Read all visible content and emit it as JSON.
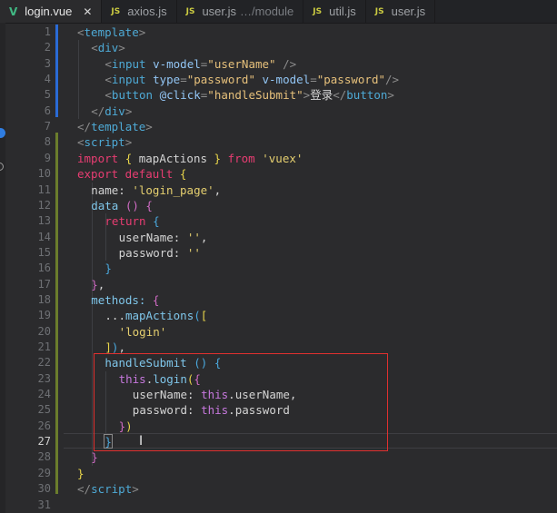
{
  "tabs": [
    {
      "icon": "V",
      "icon_type": "vue",
      "label": "login.vue",
      "suffix": "",
      "active": true,
      "close": "✕"
    },
    {
      "icon": "JS",
      "icon_type": "js",
      "label": "axios.js",
      "suffix": "",
      "active": false
    },
    {
      "icon": "JS",
      "icon_type": "js",
      "label": "user.js",
      "suffix": "…/module",
      "active": false
    },
    {
      "icon": "JS",
      "icon_type": "js",
      "label": "util.js",
      "suffix": "",
      "active": false
    },
    {
      "icon": "JS",
      "icon_type": "js",
      "label": "user.js",
      "suffix": "",
      "active": false
    }
  ],
  "editor": {
    "current_line": 27,
    "lines": [
      {
        "n": 1,
        "tokens": [
          [
            "t-punc",
            "<"
          ],
          [
            "t-tag",
            "template"
          ],
          [
            "t-punc",
            ">"
          ]
        ],
        "indent": 0
      },
      {
        "n": 2,
        "tokens": [
          [
            "t-punc",
            "<"
          ],
          [
            "t-tag",
            "div"
          ],
          [
            "t-punc",
            ">"
          ]
        ],
        "indent": 1
      },
      {
        "n": 3,
        "tokens": [
          [
            "t-punc",
            "<"
          ],
          [
            "t-tag",
            "input "
          ],
          [
            "t-attr",
            "v-model"
          ],
          [
            "t-punc",
            "="
          ],
          [
            "t-str",
            "\"userName\""
          ],
          [
            "t-punc",
            " />"
          ]
        ],
        "indent": 2
      },
      {
        "n": 4,
        "tokens": [
          [
            "t-punc",
            "<"
          ],
          [
            "t-tag",
            "input "
          ],
          [
            "t-attr",
            "type"
          ],
          [
            "t-punc",
            "="
          ],
          [
            "t-str",
            "\"password\""
          ],
          [
            "t-attr",
            " v-model"
          ],
          [
            "t-punc",
            "="
          ],
          [
            "t-str",
            "\"password\""
          ],
          [
            "t-punc",
            "/>"
          ]
        ],
        "indent": 2
      },
      {
        "n": 5,
        "tokens": [
          [
            "t-punc",
            "<"
          ],
          [
            "t-tag",
            "button "
          ],
          [
            "t-attr",
            "@click"
          ],
          [
            "t-punc",
            "="
          ],
          [
            "t-str",
            "\"handleSubmit\""
          ],
          [
            "t-punc",
            ">"
          ],
          [
            "t-prop",
            "登录"
          ],
          [
            "t-punc",
            "</"
          ],
          [
            "t-tag",
            "button"
          ],
          [
            "t-punc",
            ">"
          ]
        ],
        "indent": 2
      },
      {
        "n": 6,
        "tokens": [
          [
            "t-punc",
            "</"
          ],
          [
            "t-tag",
            "div"
          ],
          [
            "t-punc",
            ">"
          ]
        ],
        "indent": 1
      },
      {
        "n": 7,
        "tokens": [
          [
            "t-punc",
            "</"
          ],
          [
            "t-tag",
            "template"
          ],
          [
            "t-punc",
            ">"
          ]
        ],
        "indent": 0
      },
      {
        "n": 8,
        "tokens": [
          [
            "t-punc",
            "<"
          ],
          [
            "t-tag",
            "script"
          ],
          [
            "t-punc",
            ">"
          ]
        ],
        "indent": 0
      },
      {
        "n": 9,
        "tokens": [
          [
            "t-kw",
            "import "
          ],
          [
            "t-brace",
            "{ "
          ],
          [
            "t-prop",
            "mapActions "
          ],
          [
            "t-brace",
            "} "
          ],
          [
            "t-kw",
            "from "
          ],
          [
            "t-str2",
            "'vuex'"
          ]
        ],
        "indent": 0
      },
      {
        "n": 10,
        "tokens": [
          [
            "t-kw",
            "export default "
          ],
          [
            "t-brace",
            "{"
          ]
        ],
        "indent": 0
      },
      {
        "n": 11,
        "tokens": [
          [
            "t-prop",
            "name: "
          ],
          [
            "t-str2",
            "'login_page'"
          ],
          [
            "t-prop",
            ","
          ]
        ],
        "indent": 1
      },
      {
        "n": 12,
        "tokens": [
          [
            "t-fn",
            "data "
          ],
          [
            "t-brace2",
            "() "
          ],
          [
            "t-brace2",
            "{"
          ]
        ],
        "indent": 1
      },
      {
        "n": 13,
        "tokens": [
          [
            "t-kw",
            "return "
          ],
          [
            "t-brace3",
            "{"
          ]
        ],
        "indent": 2
      },
      {
        "n": 14,
        "tokens": [
          [
            "t-prop",
            "userName: "
          ],
          [
            "t-str2",
            "''"
          ],
          [
            "t-prop",
            ","
          ]
        ],
        "indent": 3
      },
      {
        "n": 15,
        "tokens": [
          [
            "t-prop",
            "password: "
          ],
          [
            "t-str2",
            "''"
          ]
        ],
        "indent": 3
      },
      {
        "n": 16,
        "tokens": [
          [
            "t-brace3",
            "}"
          ]
        ],
        "indent": 2
      },
      {
        "n": 17,
        "tokens": [
          [
            "t-brace2",
            "}"
          ],
          [
            "t-prop",
            ","
          ]
        ],
        "indent": 1
      },
      {
        "n": 18,
        "tokens": [
          [
            "t-fn",
            "methods: "
          ],
          [
            "t-brace2",
            "{"
          ]
        ],
        "indent": 1
      },
      {
        "n": 19,
        "tokens": [
          [
            "t-prop",
            "..."
          ],
          [
            "t-fn",
            "mapActions"
          ],
          [
            "t-brace3",
            "("
          ],
          [
            "t-brace",
            "["
          ]
        ],
        "indent": 2
      },
      {
        "n": 20,
        "tokens": [
          [
            "t-str2",
            "'login'"
          ]
        ],
        "indent": 3
      },
      {
        "n": 21,
        "tokens": [
          [
            "t-brace",
            "]"
          ],
          [
            "t-brace3",
            ")"
          ],
          [
            "t-prop",
            ","
          ]
        ],
        "indent": 2
      },
      {
        "n": 22,
        "tokens": [
          [
            "t-fn",
            "handleSubmit "
          ],
          [
            "t-brace3",
            "() "
          ],
          [
            "t-brace3",
            "{"
          ]
        ],
        "indent": 2
      },
      {
        "n": 23,
        "tokens": [
          [
            "t-this",
            "this"
          ],
          [
            "t-prop",
            "."
          ],
          [
            "t-fn",
            "login"
          ],
          [
            "t-brace",
            "("
          ],
          [
            "t-brace2",
            "{"
          ]
        ],
        "indent": 3
      },
      {
        "n": 24,
        "tokens": [
          [
            "t-prop",
            "userName: "
          ],
          [
            "t-this",
            "this"
          ],
          [
            "t-prop",
            ".userName,"
          ]
        ],
        "indent": 4
      },
      {
        "n": 25,
        "tokens": [
          [
            "t-prop",
            "password: "
          ],
          [
            "t-this",
            "this"
          ],
          [
            "t-prop",
            ".password"
          ]
        ],
        "indent": 4
      },
      {
        "n": 26,
        "tokens": [
          [
            "t-brace2",
            "}"
          ],
          [
            "t-brace",
            ")"
          ]
        ],
        "indent": 3
      },
      {
        "n": 27,
        "tokens": [
          [
            "t-brace3",
            "}"
          ]
        ],
        "indent": 2
      },
      {
        "n": 28,
        "tokens": [
          [
            "t-brace2",
            "}"
          ]
        ],
        "indent": 1
      },
      {
        "n": 29,
        "tokens": [
          [
            "t-brace",
            "}"
          ]
        ],
        "indent": 0
      },
      {
        "n": 30,
        "tokens": [
          [
            "t-punc",
            "</"
          ],
          [
            "t-tag",
            "script"
          ],
          [
            "t-punc",
            ">"
          ]
        ],
        "indent": 0
      },
      {
        "n": 31,
        "tokens": [],
        "indent": 0
      }
    ]
  },
  "colors": {
    "background": "#2b2b2d",
    "tab_active": "#2b2b2d",
    "highlight_box": "#e0302f",
    "git_added_bar": "#6b7d2c",
    "git_modified_bar": "#2a6bd6"
  }
}
